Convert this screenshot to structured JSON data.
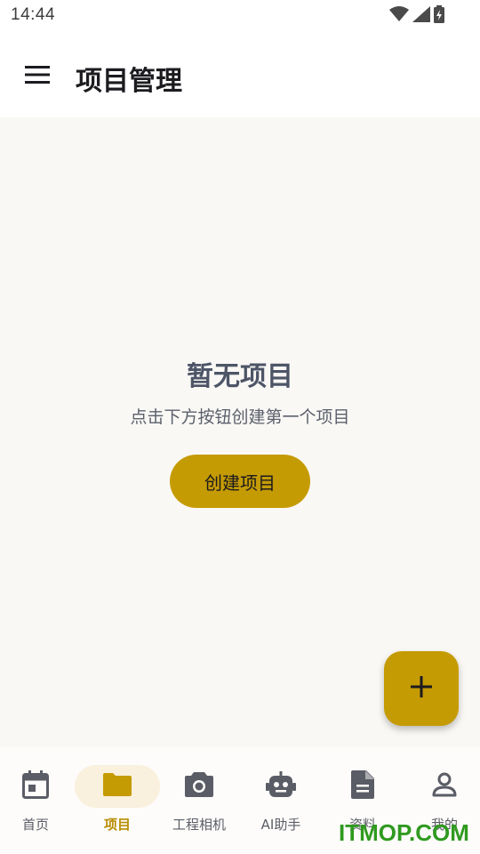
{
  "status_bar": {
    "time": "14:44",
    "icons": [
      "wifi-icon",
      "signal-icon",
      "battery-charging-icon"
    ]
  },
  "app_bar": {
    "menu_icon": "menu-icon",
    "title": "项目管理"
  },
  "empty_state": {
    "title": "暂无项目",
    "subtitle": "点击下方按钮创建第一个项目",
    "create_button_label": "创建项目"
  },
  "fab": {
    "icon": "plus-icon"
  },
  "bottom_nav": {
    "items": [
      {
        "label": "首页",
        "icon": "calendar-icon",
        "active": false
      },
      {
        "label": "项目",
        "icon": "folder-icon",
        "active": true
      },
      {
        "label": "工程相机",
        "icon": "camera-icon",
        "active": false
      },
      {
        "label": "AI助手",
        "icon": "robot-icon",
        "active": false
      },
      {
        "label": "资料",
        "icon": "document-icon",
        "active": false
      },
      {
        "label": "我的",
        "icon": "person-icon",
        "active": false
      }
    ]
  },
  "watermark": "ITMOP.COM",
  "colors": {
    "accent": "#c59b04",
    "active_label": "#b88d03",
    "active_pill": "#f9f0dd",
    "background": "#faf8f5"
  }
}
